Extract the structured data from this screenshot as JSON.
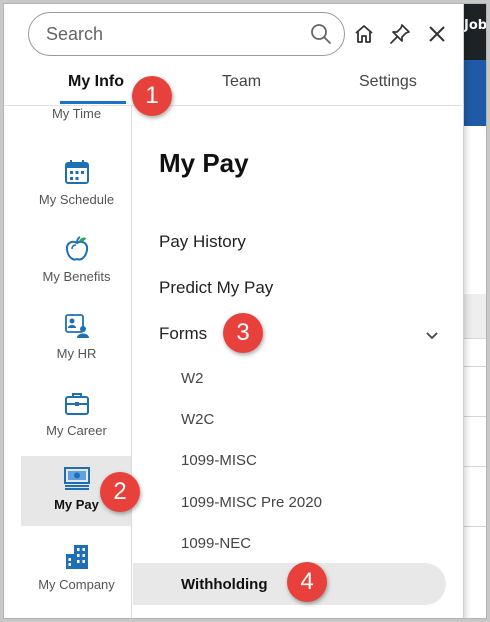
{
  "search": {
    "placeholder": "Search"
  },
  "tabs": [
    {
      "label": "My Info",
      "active": true
    },
    {
      "label": "Team",
      "active": false
    },
    {
      "label": "Settings",
      "active": false
    }
  ],
  "background_app": {
    "topbar_text": "Job"
  },
  "sidebar": {
    "items": [
      {
        "label": "My Time",
        "icon": "clock-icon"
      },
      {
        "label": "My Schedule",
        "icon": "calendar-icon"
      },
      {
        "label": "My Benefits",
        "icon": "apple-icon"
      },
      {
        "label": "My HR",
        "icon": "people-icon"
      },
      {
        "label": "My Career",
        "icon": "briefcase-icon"
      },
      {
        "label": "My Pay",
        "icon": "money-icon",
        "active": true
      },
      {
        "label": "My Company",
        "icon": "building-icon"
      }
    ]
  },
  "content": {
    "title": "My Pay",
    "menu": [
      {
        "label": "Pay History"
      },
      {
        "label": "Predict My Pay"
      },
      {
        "label": "Forms",
        "expanded": true
      }
    ],
    "forms_submenu": [
      {
        "label": "W2"
      },
      {
        "label": "W2C"
      },
      {
        "label": "1099-MISC"
      },
      {
        "label": "1099-MISC Pre 2020"
      },
      {
        "label": "1099-NEC"
      },
      {
        "label": "Withholding",
        "active": true
      }
    ]
  },
  "annotations": [
    "1",
    "2",
    "3",
    "4"
  ],
  "colors": {
    "accent_blue": "#1a73c8",
    "icon_blue": "#1f6fb5",
    "badge_red": "#e8403a",
    "active_bg": "#e7e7e7"
  }
}
